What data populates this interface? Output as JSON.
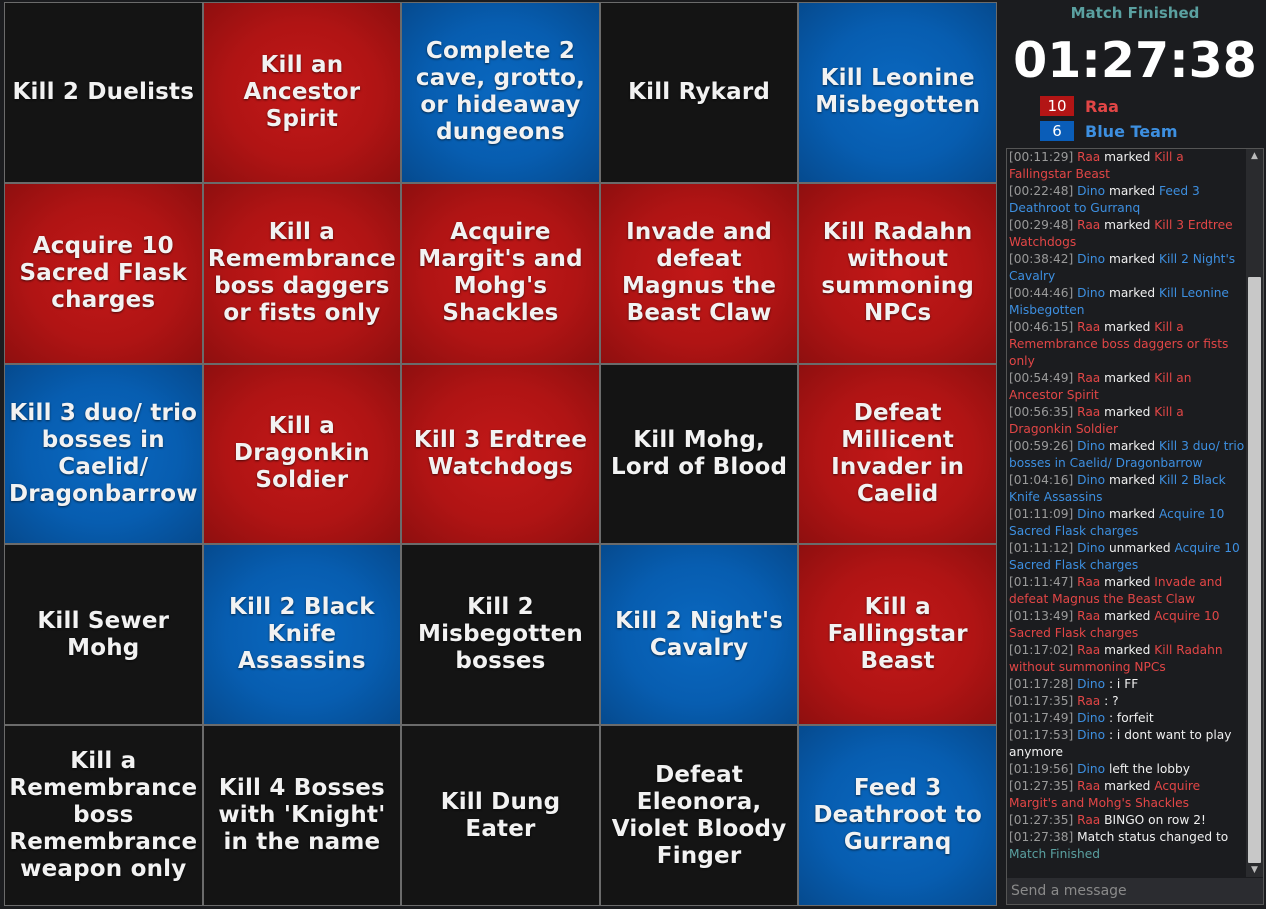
{
  "board": {
    "cells": [
      {
        "text": "Kill 2 Duelists",
        "color": "black"
      },
      {
        "text": "Kill an Ancestor Spirit",
        "color": "red"
      },
      {
        "text": "Complete 2 cave, grotto, or hideaway dungeons",
        "color": "blue"
      },
      {
        "text": "Kill Rykard",
        "color": "black"
      },
      {
        "text": "Kill Leonine Misbegotten",
        "color": "blue"
      },
      {
        "text": "Acquire 10 Sacred Flask charges",
        "color": "red"
      },
      {
        "text": "Kill a Remembrance boss daggers or fists only",
        "color": "red"
      },
      {
        "text": "Acquire Margit's and Mohg's Shackles",
        "color": "red"
      },
      {
        "text": "Invade and defeat Magnus the Beast Claw",
        "color": "red"
      },
      {
        "text": "Kill Radahn without summoning NPCs",
        "color": "red"
      },
      {
        "text": "Kill 3 duo/ trio bosses in Caelid/ Dragonbarrow",
        "color": "blue"
      },
      {
        "text": "Kill a Dragonkin Soldier",
        "color": "red"
      },
      {
        "text": "Kill 3 Erdtree Watchdogs",
        "color": "red"
      },
      {
        "text": "Kill Mohg, Lord of Blood",
        "color": "black"
      },
      {
        "text": "Defeat Millicent Invader in Caelid",
        "color": "red"
      },
      {
        "text": "Kill Sewer Mohg",
        "color": "black"
      },
      {
        "text": "Kill 2 Black Knife Assassins",
        "color": "blue"
      },
      {
        "text": "Kill 2 Misbegotten bosses",
        "color": "black"
      },
      {
        "text": "Kill 2 Night's Cavalry",
        "color": "blue"
      },
      {
        "text": "Kill a Fallingstar Beast",
        "color": "red"
      },
      {
        "text": "Kill a Remembrance boss Remembrance weapon only",
        "color": "black"
      },
      {
        "text": "Kill 4 Bosses with 'Knight' in the name",
        "color": "black"
      },
      {
        "text": "Kill Dung Eater",
        "color": "black"
      },
      {
        "text": "Defeat Eleonora, Violet Bloody Finger",
        "color": "black"
      },
      {
        "text": "Feed 3 Deathroot to Gurranq",
        "color": "blue"
      }
    ]
  },
  "match": {
    "status": "Match Finished",
    "timer": "01:27:38",
    "teams": [
      {
        "score": "10",
        "name": "Raa",
        "color": "#b31515"
      },
      {
        "score": "6",
        "name": "Blue Team",
        "color": "#0a5db8"
      }
    ]
  },
  "chat": {
    "messages": [
      {
        "time": "[00:11:29]",
        "user": "Raa",
        "team": "red",
        "action": "marked",
        "goal": "Kill a Fallingstar Beast"
      },
      {
        "time": "[00:22:48]",
        "user": "Dino",
        "team": "blue",
        "action": "marked",
        "goal": "Feed 3 Deathroot to Gurranq"
      },
      {
        "time": "[00:29:48]",
        "user": "Raa",
        "team": "red",
        "action": "marked",
        "goal": "Kill 3 Erdtree Watchdogs"
      },
      {
        "time": "[00:38:42]",
        "user": "Dino",
        "team": "blue",
        "action": "marked",
        "goal": "Kill 2 Night's Cavalry"
      },
      {
        "time": "[00:44:46]",
        "user": "Dino",
        "team": "blue",
        "action": "marked",
        "goal": "Kill Leonine Misbegotten"
      },
      {
        "time": "[00:46:15]",
        "user": "Raa",
        "team": "red",
        "action": "marked",
        "goal": "Kill a Remembrance boss daggers or fists only"
      },
      {
        "time": "[00:54:49]",
        "user": "Raa",
        "team": "red",
        "action": "marked",
        "goal": "Kill an Ancestor Spirit"
      },
      {
        "time": "[00:56:35]",
        "user": "Raa",
        "team": "red",
        "action": "marked",
        "goal": "Kill a Dragonkin Soldier"
      },
      {
        "time": "[00:59:26]",
        "user": "Dino",
        "team": "blue",
        "action": "marked",
        "goal": "Kill 3 duo/ trio bosses in Caelid/ Dragonbarrow"
      },
      {
        "time": "[01:04:16]",
        "user": "Dino",
        "team": "blue",
        "action": "marked",
        "goal": "Kill 2 Black Knife Assassins"
      },
      {
        "time": "[01:11:09]",
        "user": "Dino",
        "team": "blue",
        "action": "marked",
        "goal": "Acquire 10 Sacred Flask charges"
      },
      {
        "time": "[01:11:12]",
        "user": "Dino",
        "team": "blue",
        "action": "unmarked",
        "goal": "Acquire 10 Sacred Flask charges"
      },
      {
        "time": "[01:11:47]",
        "user": "Raa",
        "team": "red",
        "action": "marked",
        "goal": "Invade and defeat Magnus the Beast Claw"
      },
      {
        "time": "[01:13:49]",
        "user": "Raa",
        "team": "red",
        "action": "marked",
        "goal": "Acquire 10 Sacred Flask charges"
      },
      {
        "time": "[01:17:02]",
        "user": "Raa",
        "team": "red",
        "action": "marked",
        "goal": "Kill Radahn without summoning NPCs"
      },
      {
        "time": "[01:17:28]",
        "user": "Dino",
        "team": "blue",
        "action": "",
        "text": " : i FF"
      },
      {
        "time": "[01:17:35]",
        "user": "Raa",
        "team": "red",
        "action": "",
        "text": " : ?"
      },
      {
        "time": "[01:17:49]",
        "user": "Dino",
        "team": "blue",
        "action": "",
        "text": " : forfeit"
      },
      {
        "time": "[01:17:53]",
        "user": "Dino",
        "team": "blue",
        "action": "",
        "text": " : i dont want to play anymore"
      },
      {
        "time": "[01:19:56]",
        "user": "Dino",
        "team": "blue",
        "action": "",
        "text": " left the lobby"
      },
      {
        "time": "[01:27:35]",
        "user": "Raa",
        "team": "red",
        "action": "marked",
        "goal": "Acquire Margit's and Mohg's Shackles"
      },
      {
        "time": "[01:27:35]",
        "user": "Raa",
        "team": "red",
        "action": "",
        "text": " BINGO on row 2!"
      },
      {
        "time": "[01:27:38]",
        "user": "",
        "team": "",
        "action": "",
        "text": "Match status changed to ",
        "status": "Match Finished"
      }
    ],
    "input_placeholder": "Send a message"
  },
  "icons": {
    "scroll_up": "scroll-up-arrow",
    "scroll_down": "scroll-down-arrow"
  }
}
